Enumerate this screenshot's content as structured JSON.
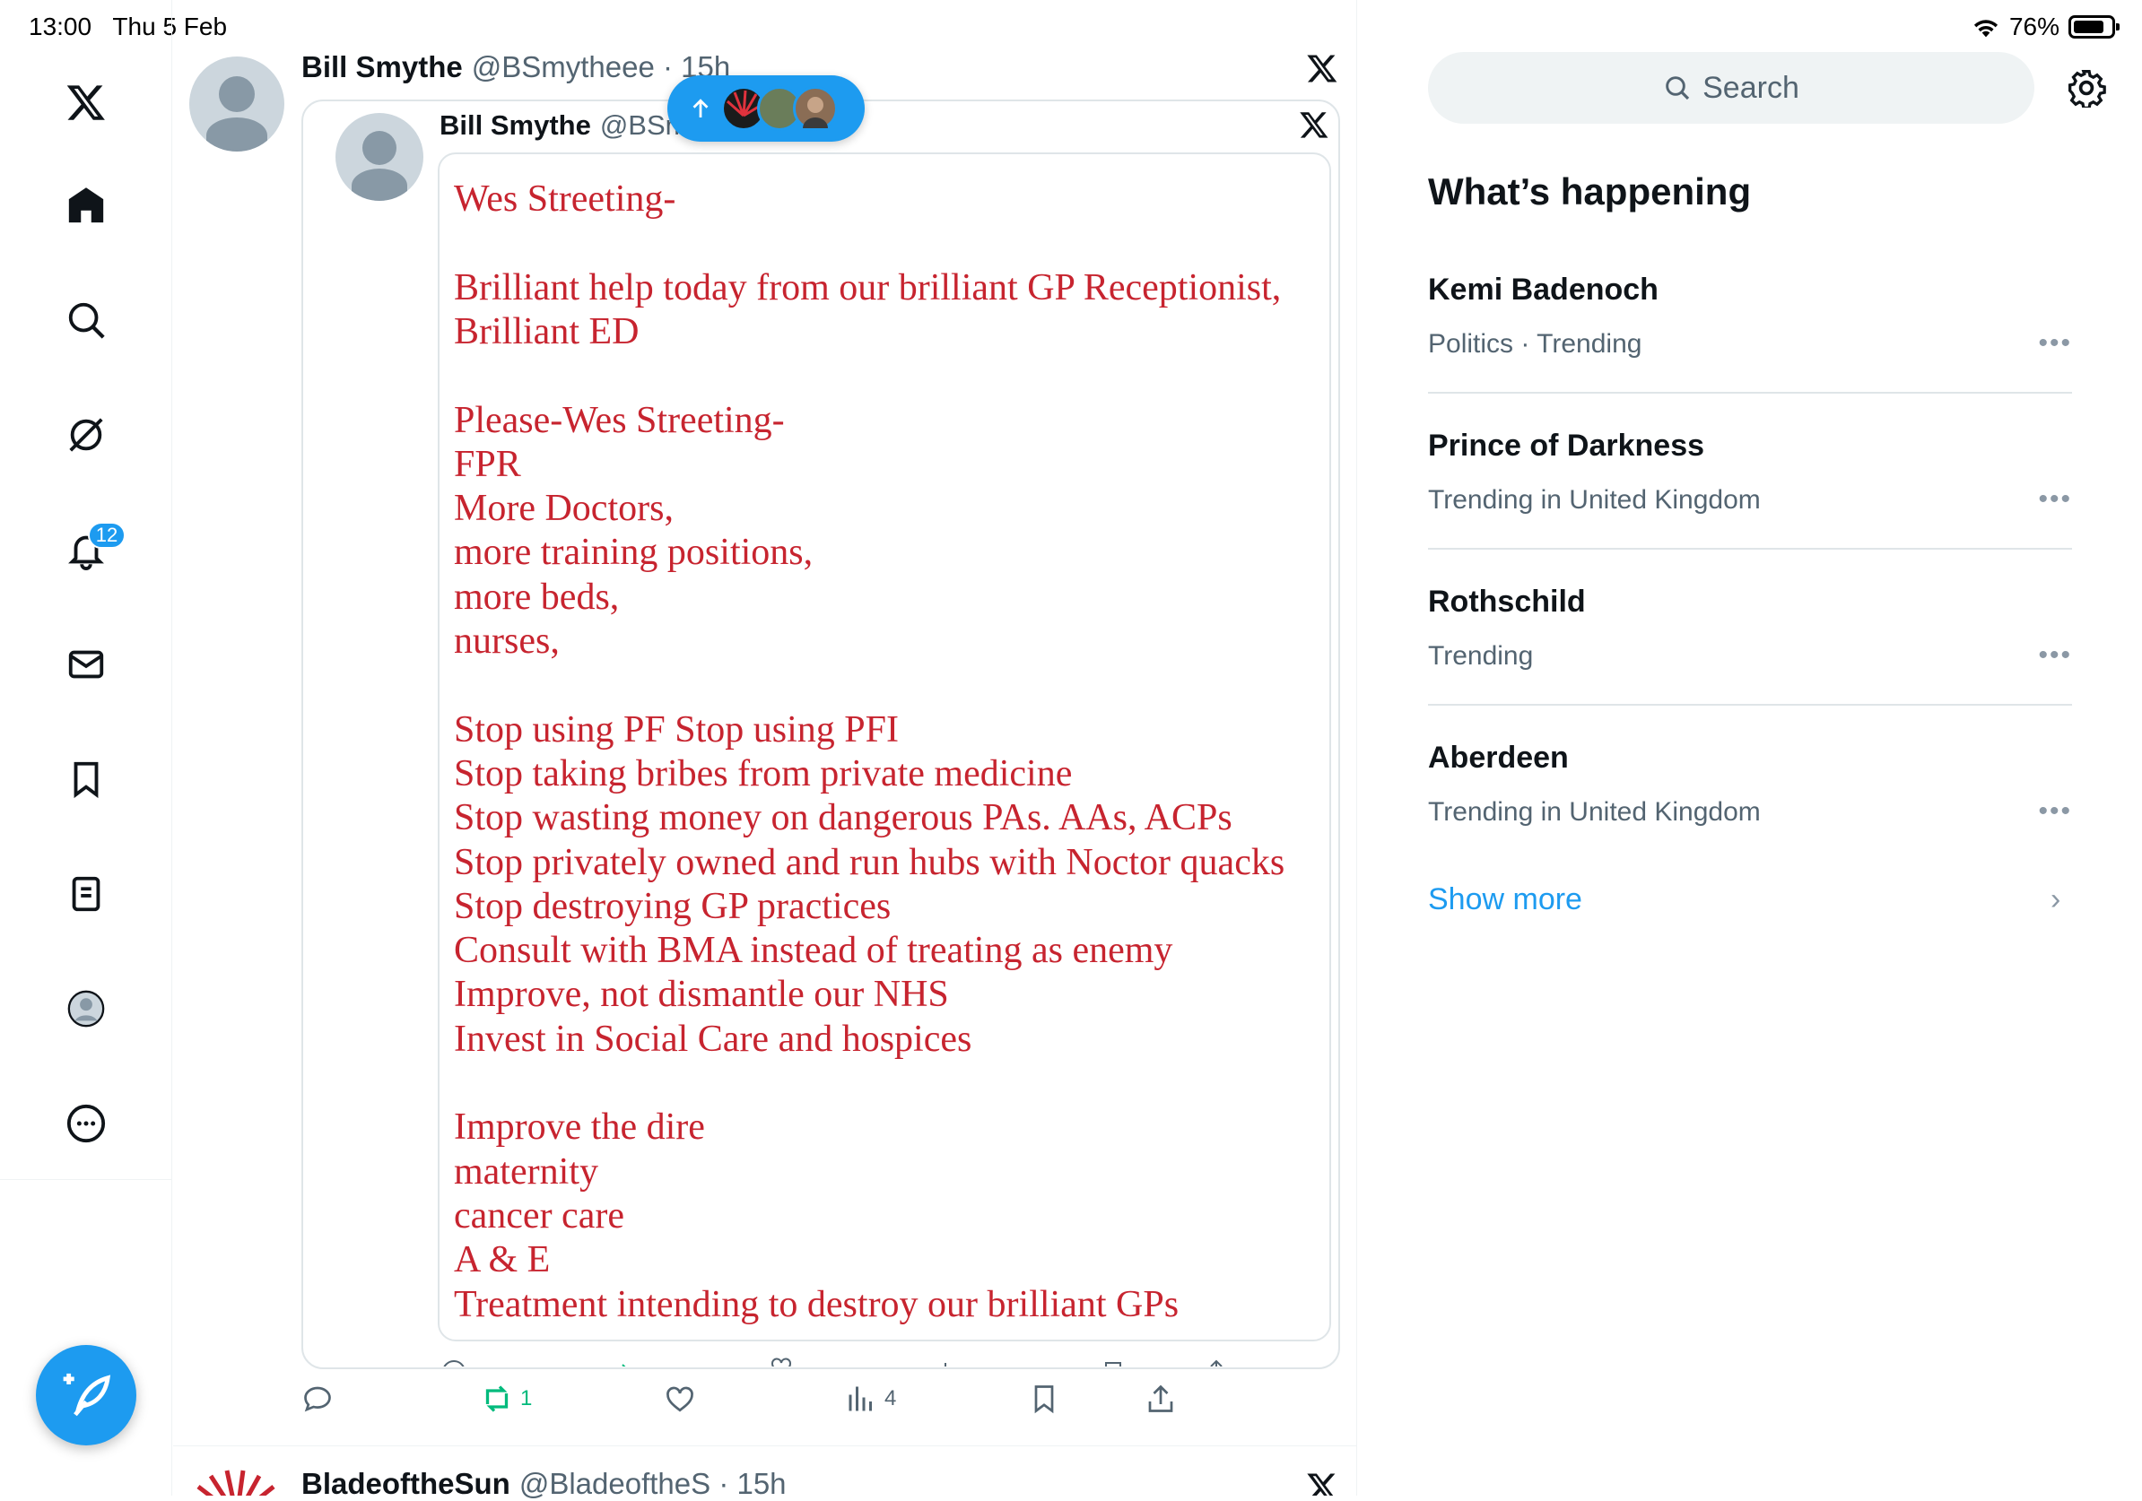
{
  "status_bar": {
    "time": "13:00",
    "date": "Thu 5 Feb",
    "battery": "76%"
  },
  "nav": {
    "notifications_count": "12"
  },
  "post": {
    "name": "Bill Smythe",
    "handle_time": "@BSmytheee · 15h",
    "quote": {
      "name": "Bill Smythe",
      "handle": "@BSm",
      "image_lines": [
        "Wes Streeting-",
        "",
        "Brilliant help today from our brilliant GP Receptionist,",
        "Brilliant ED",
        "",
        "Please-Wes Streeting-",
        "FPR",
        "More Doctors,",
        "more training positions,",
        "more beds,",
        "nurses,",
        "",
        "Stop using PF Stop using PFI",
        "Stop taking bribes from private medicine",
        "Stop wasting money on dangerous PAs. AAs, ACPs",
        "Stop privately owned and run hubs with Noctor quacks",
        "Stop destroying GP practices",
        "Consult with BMA instead of treating as enemy",
        "Improve, not dismantle our NHS",
        "Invest in Social Care and hospices",
        "",
        "Improve the dire",
        "maternity",
        "cancer care",
        "A & E",
        "Treatment intending to destroy our brilliant GPs"
      ]
    },
    "actions": {
      "reply": "",
      "repost": "1",
      "like": "",
      "views": "4"
    }
  },
  "next_post": {
    "name": "BladeoftheSun",
    "handle_time": "@BladeoftheS · 15h"
  },
  "sidebar": {
    "search_placeholder": "Search",
    "section_title": "What’s happening",
    "trends": [
      {
        "name": "Kemi Badenoch",
        "meta": "Politics · Trending"
      },
      {
        "name": "Prince of Darkness",
        "meta": "Trending in United Kingdom"
      },
      {
        "name": "Rothschild",
        "meta": "Trending"
      },
      {
        "name": "Aberdeen",
        "meta": "Trending in United Kingdom"
      }
    ],
    "show_more": "Show more"
  },
  "colors": {
    "accent": "#1d9bf0",
    "repost_active": "#00ba7c",
    "doc_text": "#c7242f"
  }
}
